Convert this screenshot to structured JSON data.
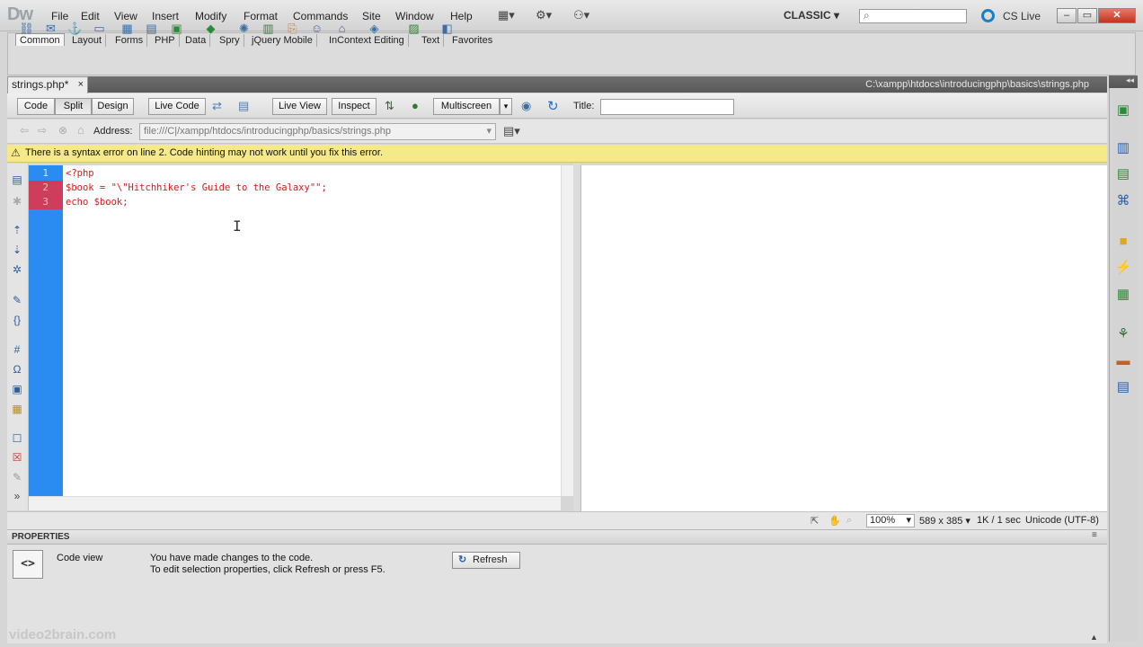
{
  "app": {
    "logo": "Dw"
  },
  "menu": [
    "File",
    "Edit",
    "View",
    "Insert",
    "Modify",
    "Format",
    "Commands",
    "Site",
    "Window",
    "Help"
  ],
  "menu_icons": {
    "layout": "▦▾",
    "gear": "⚙▾",
    "site": "⚇▾"
  },
  "workspace": {
    "label": "CLASSIC ▾"
  },
  "search": {
    "icon": "⌕",
    "placeholder": ""
  },
  "cslive": {
    "label": "CS Live"
  },
  "window_buttons": {
    "min": "–",
    "max": "▭",
    "close": "✕"
  },
  "insert_tabs": [
    "Common",
    "Layout",
    "Forms",
    "PHP",
    "Data",
    "Spry",
    "jQuery Mobile",
    "InContext Editing",
    "Text",
    "Favorites"
  ],
  "document": {
    "tab_label": "strings.php*",
    "tab_close": "×",
    "path": "C:\\xampp\\htdocs\\introducingphp\\basics\\strings.php"
  },
  "doc_toolbar": {
    "code": "Code",
    "split": "Split",
    "design": "Design",
    "live_code": "Live Code",
    "live_view": "Live View",
    "inspect": "Inspect",
    "multiscreen": "Multiscreen",
    "title_label": "Title:",
    "title_value": ""
  },
  "address": {
    "label": "Address:",
    "value": "file:///C|/xampp/htdocs/introducingphp/basics/strings.php"
  },
  "warning": {
    "icon": "⚠",
    "text": "There is a syntax error on line 2.  Code hinting may not work until you fix this error."
  },
  "code_lines": [
    {
      "num": "1",
      "text": "<?php",
      "error": false
    },
    {
      "num": "2",
      "text": "$book = \"\\\"Hitchhiker's Guide to the Galaxy\"\";",
      "error": true
    },
    {
      "num": "3",
      "text": "echo $book;",
      "error": true
    }
  ],
  "status": {
    "zoom": "100%",
    "size": "589 x 385 ▾",
    "weight": "1K / 1 sec",
    "encoding": "Unicode (UTF-8)"
  },
  "properties": {
    "title": "PROPERTIES",
    "icon": "<>",
    "view_label": "Code view",
    "message_line1": "You have made changes to the code.",
    "message_line2": "To edit selection properties, click Refresh or press F5.",
    "refresh_label": "Refresh",
    "refresh_icon": "↻"
  },
  "watermark": "video2brain.com",
  "colors": {
    "gutter": "#2a8cf0",
    "error_line": "#cf3d5d",
    "code_text": "#d21b1b",
    "warning_bg": "#f6e98a"
  }
}
